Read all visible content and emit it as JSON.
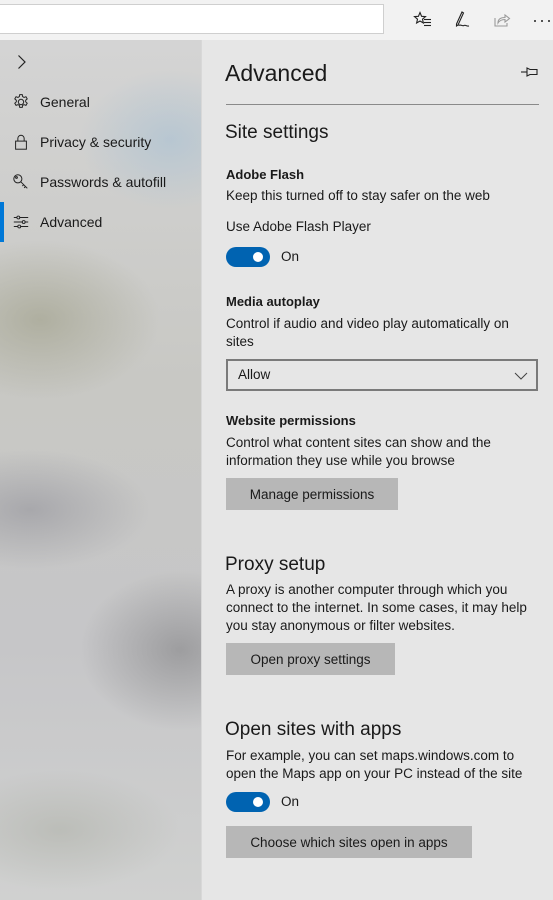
{
  "toolbar": {
    "address_value": "",
    "icons": [
      "favorites-list-icon",
      "pen-notes-icon",
      "share-icon",
      "more-icon"
    ]
  },
  "sidebar": {
    "expand_icon": "chevron-right-icon",
    "items": [
      {
        "label": "General",
        "icon": "gear-icon",
        "active": false
      },
      {
        "label": "Privacy & security",
        "icon": "lock-icon",
        "active": false
      },
      {
        "label": "Passwords & autofill",
        "icon": "key-icon",
        "active": false
      },
      {
        "label": "Advanced",
        "icon": "sliders-icon",
        "active": true
      }
    ],
    "accent_color": "#0078d7"
  },
  "panel": {
    "title": "Advanced",
    "pin_icon": "pin-icon",
    "site_settings": {
      "heading": "Site settings",
      "adobe_flash": {
        "heading": "Adobe Flash",
        "description": "Keep this turned off to stay safer on the web",
        "toggle_label": "Use Adobe Flash Player",
        "toggle_state": "On",
        "toggle_on": true
      },
      "media_autoplay": {
        "heading": "Media autoplay",
        "description": "Control if audio and video play automatically on sites",
        "selected": "Allow"
      },
      "website_permissions": {
        "heading": "Website permissions",
        "description": "Control what content sites can show and the information they use while you browse",
        "button": "Manage permissions"
      }
    },
    "proxy": {
      "heading": "Proxy setup",
      "description": "A proxy is another computer through which you connect to the internet. In some cases, it may help you stay anonymous or filter websites.",
      "button": "Open proxy settings"
    },
    "open_with_apps": {
      "heading": "Open sites with apps",
      "description": "For example, you can set maps.windows.com to open the Maps app on your PC instead of the site",
      "toggle_state": "On",
      "toggle_on": true,
      "button": "Choose which sites open in apps"
    },
    "toggle_color": "#0063b1"
  }
}
